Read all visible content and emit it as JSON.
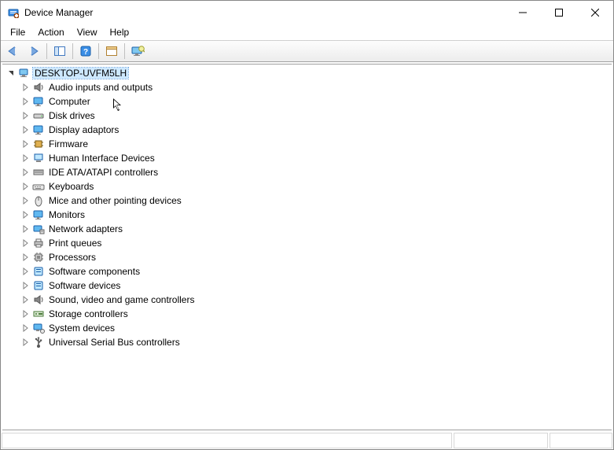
{
  "window": {
    "title": "Device Manager"
  },
  "menubar": {
    "file": "File",
    "action": "Action",
    "view": "View",
    "help": "Help"
  },
  "tree": {
    "root": {
      "label": "DESKTOP-UVFM5LH",
      "expanded": true
    },
    "nodes": [
      {
        "label": "Audio inputs and outputs",
        "icon": "speaker"
      },
      {
        "label": "Computer",
        "icon": "monitor"
      },
      {
        "label": "Disk drives",
        "icon": "drive"
      },
      {
        "label": "Display adaptors",
        "icon": "monitor"
      },
      {
        "label": "Firmware",
        "icon": "chip"
      },
      {
        "label": "Human Interface Devices",
        "icon": "hid"
      },
      {
        "label": "IDE ATA/ATAPI controllers",
        "icon": "ide"
      },
      {
        "label": "Keyboards",
        "icon": "keyboard"
      },
      {
        "label": "Mice and other pointing devices",
        "icon": "mouse"
      },
      {
        "label": "Monitors",
        "icon": "monitor"
      },
      {
        "label": "Network adapters",
        "icon": "network"
      },
      {
        "label": "Print queues",
        "icon": "printer"
      },
      {
        "label": "Processors",
        "icon": "cpu"
      },
      {
        "label": "Software components",
        "icon": "software"
      },
      {
        "label": "Software devices",
        "icon": "software"
      },
      {
        "label": "Sound, video and game controllers",
        "icon": "speaker"
      },
      {
        "label": "Storage controllers",
        "icon": "storage"
      },
      {
        "label": "System devices",
        "icon": "system"
      },
      {
        "label": "Universal Serial Bus controllers",
        "icon": "usb"
      }
    ]
  }
}
